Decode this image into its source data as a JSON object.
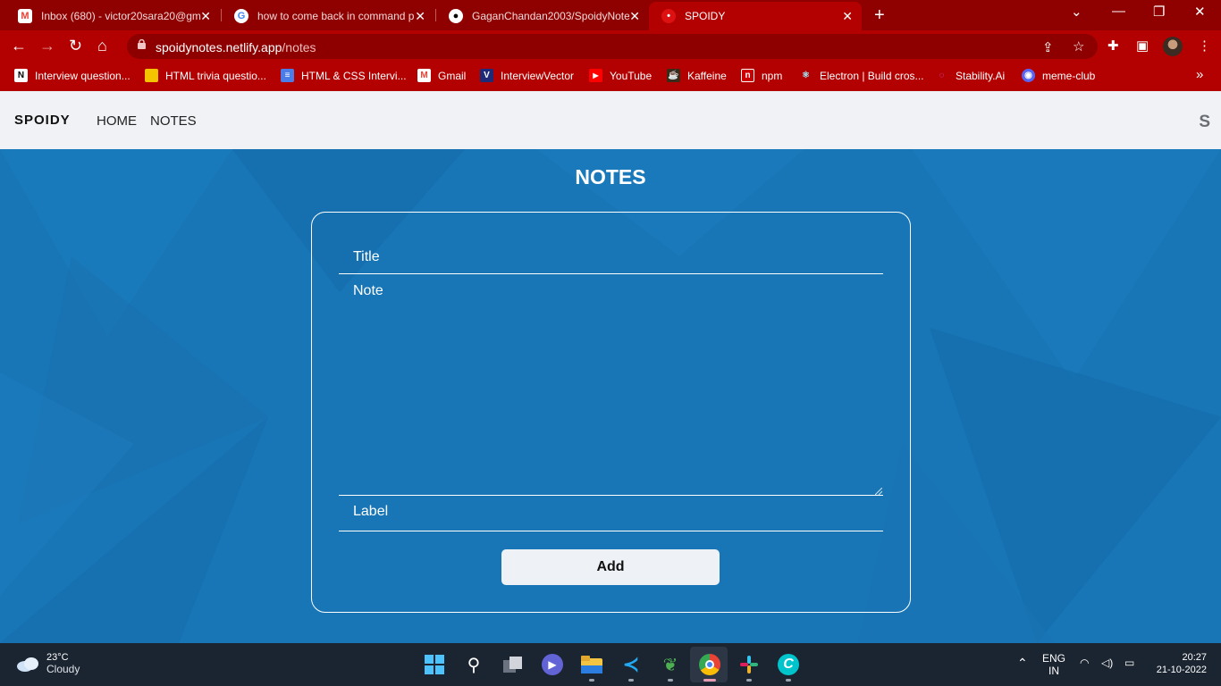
{
  "browser": {
    "tabs": [
      {
        "title": "Inbox (680) - victor20sara20@gm",
        "icon": "gmail-icon",
        "active": false
      },
      {
        "title": "how to come back in command p",
        "icon": "google-icon",
        "active": false
      },
      {
        "title": "GaganChandan2003/SpoidyNote",
        "icon": "github-icon",
        "active": false
      },
      {
        "title": "SPOIDY",
        "icon": "spoidy-icon",
        "active": true
      }
    ],
    "url_host": "spoidynotes.netlify.app",
    "url_path": "/notes",
    "bookmarks": [
      "Interview question...",
      "HTML trivia questio...",
      "HTML & CSS Intervi...",
      "Gmail",
      "InterviewVector",
      "YouTube",
      "Kaffeine",
      "npm",
      "Electron | Build cros...",
      "Stability.Ai",
      "meme-club"
    ],
    "more_bookmarks": "»"
  },
  "app": {
    "brand": "SPOIDY",
    "nav": [
      "HOME",
      "NOTES"
    ],
    "nav_right": "S",
    "heading": "NOTES",
    "form": {
      "title_placeholder": "Title",
      "note_placeholder": "Note",
      "label_placeholder": "Label",
      "add_label": "Add"
    }
  },
  "taskbar": {
    "temperature": "23°C",
    "weather": "Cloudy",
    "language": "ENG",
    "region": "IN",
    "time": "20:27",
    "date": "21-10-2022"
  },
  "colors": {
    "browser_frame": "#8f0000",
    "browser_toolbar": "#b30000",
    "page_background": "#1875b6",
    "navbar": "#f0f2f5",
    "taskbar": "#1b2431"
  }
}
